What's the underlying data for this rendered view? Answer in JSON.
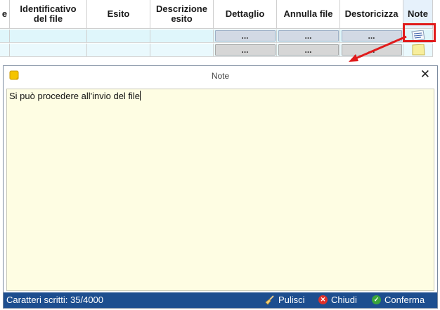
{
  "grid": {
    "columns": [
      {
        "label": "e",
        "width": 14
      },
      {
        "label": "Identificativo\ndel file",
        "width": 110
      },
      {
        "label": "Esito",
        "width": 90
      },
      {
        "label": "Descrizione\nesito",
        "width": 90
      },
      {
        "label": "Dettaglio",
        "width": 90
      },
      {
        "label": "Annulla file",
        "width": 90
      },
      {
        "label": "Destoricizza",
        "width": 90
      },
      {
        "label": "Note",
        "width": 42
      }
    ],
    "button_label": "..."
  },
  "dialog": {
    "title": "Note",
    "close_symbol": "✕",
    "text": "Si può procedere all'invio del file",
    "char_count": "Caratteri scritti: 35/4000",
    "clear_label": "Pulisci",
    "close_label": "Chiudi",
    "confirm_label": "Conferma"
  },
  "colors": {
    "statusbar": "#1d4e8f",
    "highlight": "#e01b1b",
    "textarea_bg": "#fefde3"
  },
  "icons": [
    "note-icon",
    "sticky-note-icon",
    "broom-icon",
    "close-circle-icon",
    "check-circle-icon"
  ]
}
